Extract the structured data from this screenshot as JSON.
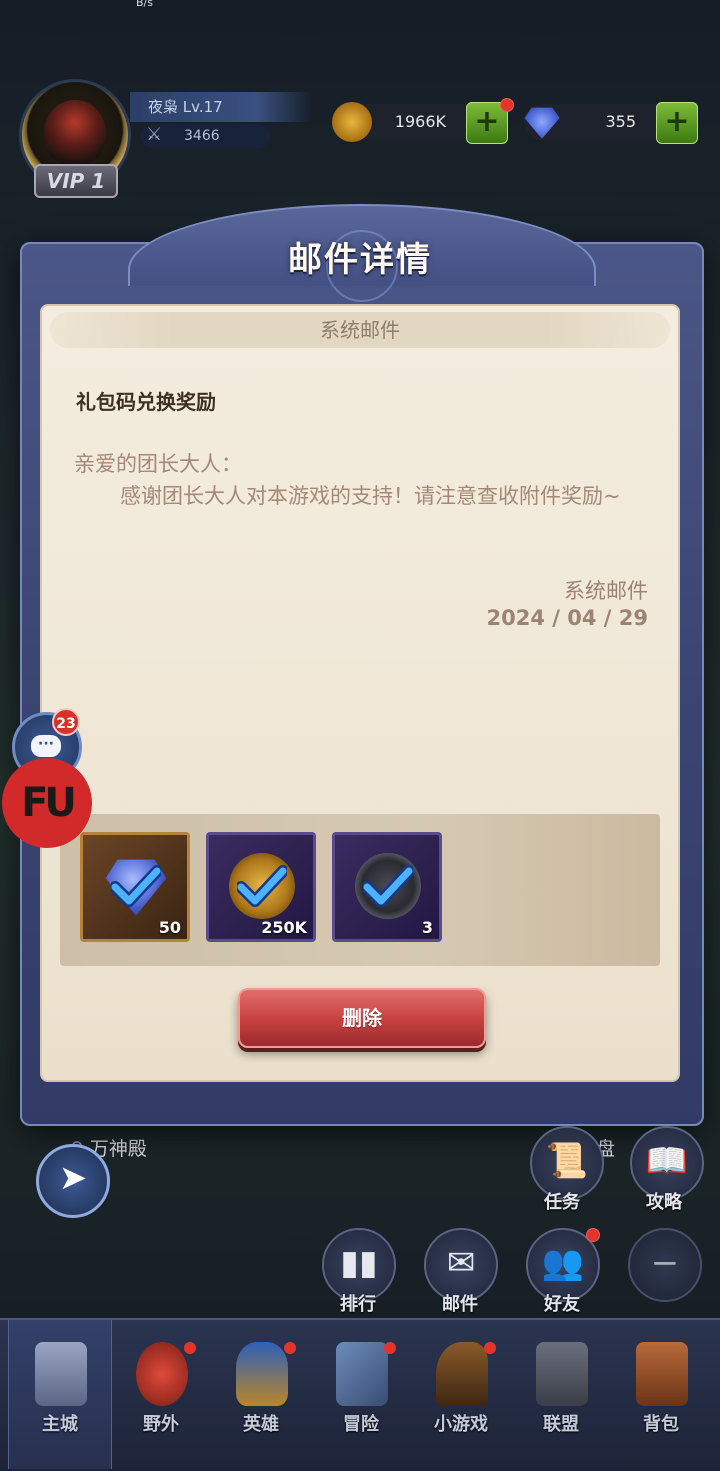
{
  "status_bar": {
    "speed": "B/s"
  },
  "player": {
    "name_level": "夜枭 Lv.17",
    "power": "3466",
    "vip": "VIP 1"
  },
  "resources": {
    "gold": "1966K",
    "gems": "355"
  },
  "dialog": {
    "title": "邮件详情",
    "category_tab": "系统邮件",
    "subject": "礼包码兑换奖励",
    "greeting": "亲爱的团长大人：",
    "body": "感谢团长大人对本游戏的支持！请注意查收附件奖励~",
    "sender": "系统邮件",
    "date": "2024 / 04 / 29",
    "attachments": [
      {
        "icon": "diamond-icon",
        "quantity": "50"
      },
      {
        "icon": "gold-coin-icon",
        "quantity": "250K"
      },
      {
        "icon": "dark-orb-icon",
        "quantity": "3"
      }
    ],
    "delete_label": "删除"
  },
  "side": {
    "chat_badge": "23",
    "chat_icon_text": "···",
    "logo_text": "FU",
    "pantheon": "万神殿",
    "pan_label_partial": "盘"
  },
  "actions": [
    {
      "label": "任务",
      "icon": "quest-scroll-icon"
    },
    {
      "label": "攻略",
      "icon": "guide-book-icon"
    },
    {
      "label": "排行",
      "icon": "ranking-icon"
    },
    {
      "label": "邮件",
      "icon": "mail-icon"
    },
    {
      "label": "好友",
      "icon": "friends-icon"
    }
  ],
  "bottom_nav": [
    {
      "label": "主城",
      "icon": "castle-tower-icon",
      "active": true
    },
    {
      "label": "野外",
      "icon": "target-icon",
      "dot": true
    },
    {
      "label": "英雄",
      "icon": "hero-helmet-icon",
      "dot": true
    },
    {
      "label": "冒险",
      "icon": "crossed-swords-icon",
      "dot": true
    },
    {
      "label": "小游戏",
      "icon": "knight-chess-icon",
      "dot": true
    },
    {
      "label": "联盟",
      "icon": "alliance-banner-icon"
    },
    {
      "label": "背包",
      "icon": "backpack-icon"
    }
  ],
  "colors": {
    "dialog_frame": "#3b4573",
    "paper": "#f4eddf",
    "delete_button": "#c6403f",
    "badge_red": "#d8302b"
  }
}
